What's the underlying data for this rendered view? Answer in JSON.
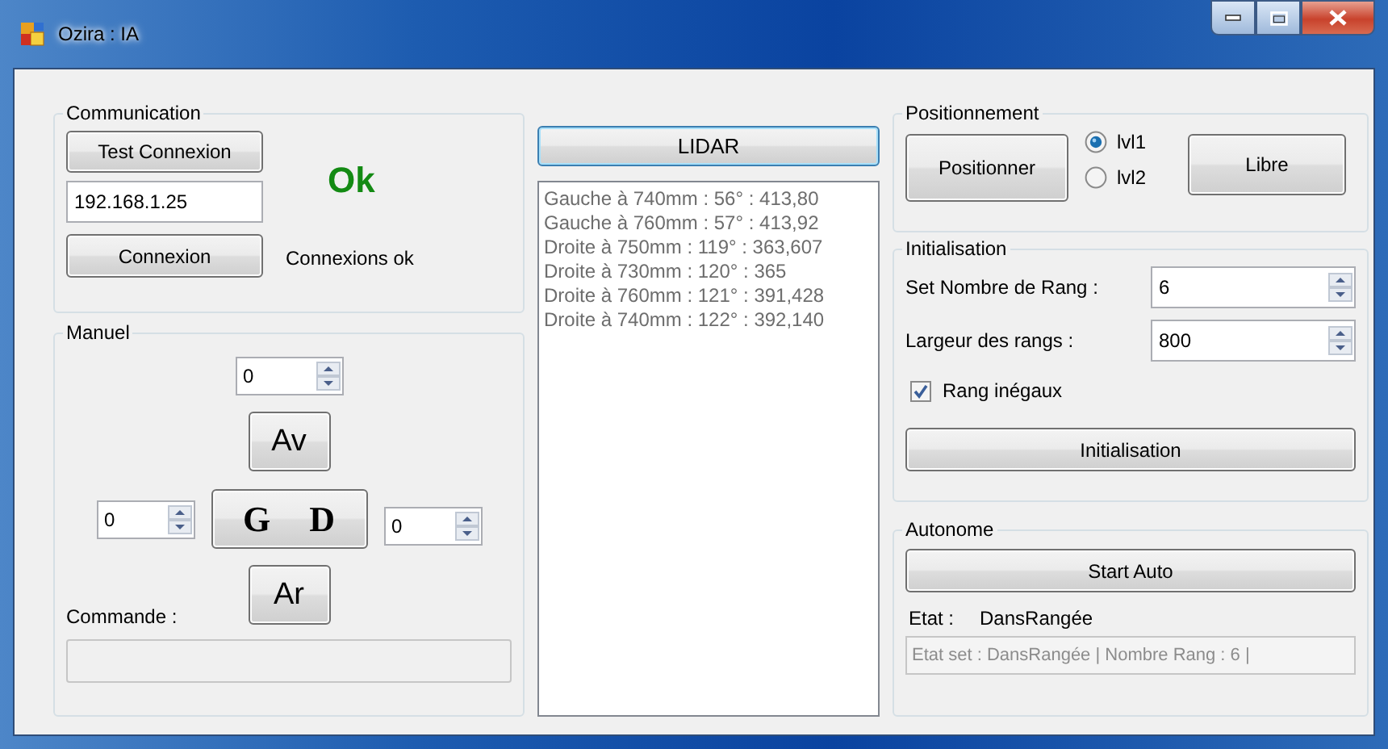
{
  "window": {
    "title": "Ozira : IA"
  },
  "communication": {
    "title": "Communication",
    "test_button": "Test Connexion",
    "status": "Ok",
    "ip_field": {
      "value": "192.168.1.25"
    },
    "connect_button": "Connexion",
    "connection_status": "Connexions ok"
  },
  "manuel": {
    "title": "Manuel",
    "speed_spin": {
      "value": "0"
    },
    "forward_button": "Av",
    "left_spin": {
      "value": "0"
    },
    "turn_button": {
      "left": "G",
      "right": "D"
    },
    "right_spin": {
      "value": "0"
    },
    "back_button": "Ar",
    "command_label": "Commande :"
  },
  "lidar": {
    "button": "LIDAR",
    "readings": [
      "Gauche à 740mm : 56° : 413,80",
      "Gauche à 760mm : 57° : 413,92",
      "Droite à 750mm : 119° : 363,607",
      "Droite à 730mm : 120° : 365",
      "Droite à 760mm : 121° : 391,428",
      "Droite à 740mm : 122° : 392,140"
    ]
  },
  "positionnement": {
    "title": "Positionnement",
    "position_button": "Positionner",
    "levels": [
      {
        "label": "lvl1",
        "selected": true
      },
      {
        "label": "lvl2",
        "selected": false
      }
    ],
    "free_button": "Libre"
  },
  "initialisation": {
    "title": "Initialisation",
    "fields": [
      {
        "label": "Set Nombre de Rang :",
        "value": "6"
      },
      {
        "label": "Largeur des rangs :",
        "value": "800"
      }
    ],
    "uneven": {
      "label": "Rang inégaux",
      "checked": true
    },
    "button": "Initialisation"
  },
  "autonome": {
    "title": "Autonome",
    "start_button": "Start Auto",
    "state_label": "Etat :",
    "state": "DansRangée",
    "state_field": {
      "value": "Etat set : DansRangée | Nombre Rang : 6 |"
    }
  }
}
